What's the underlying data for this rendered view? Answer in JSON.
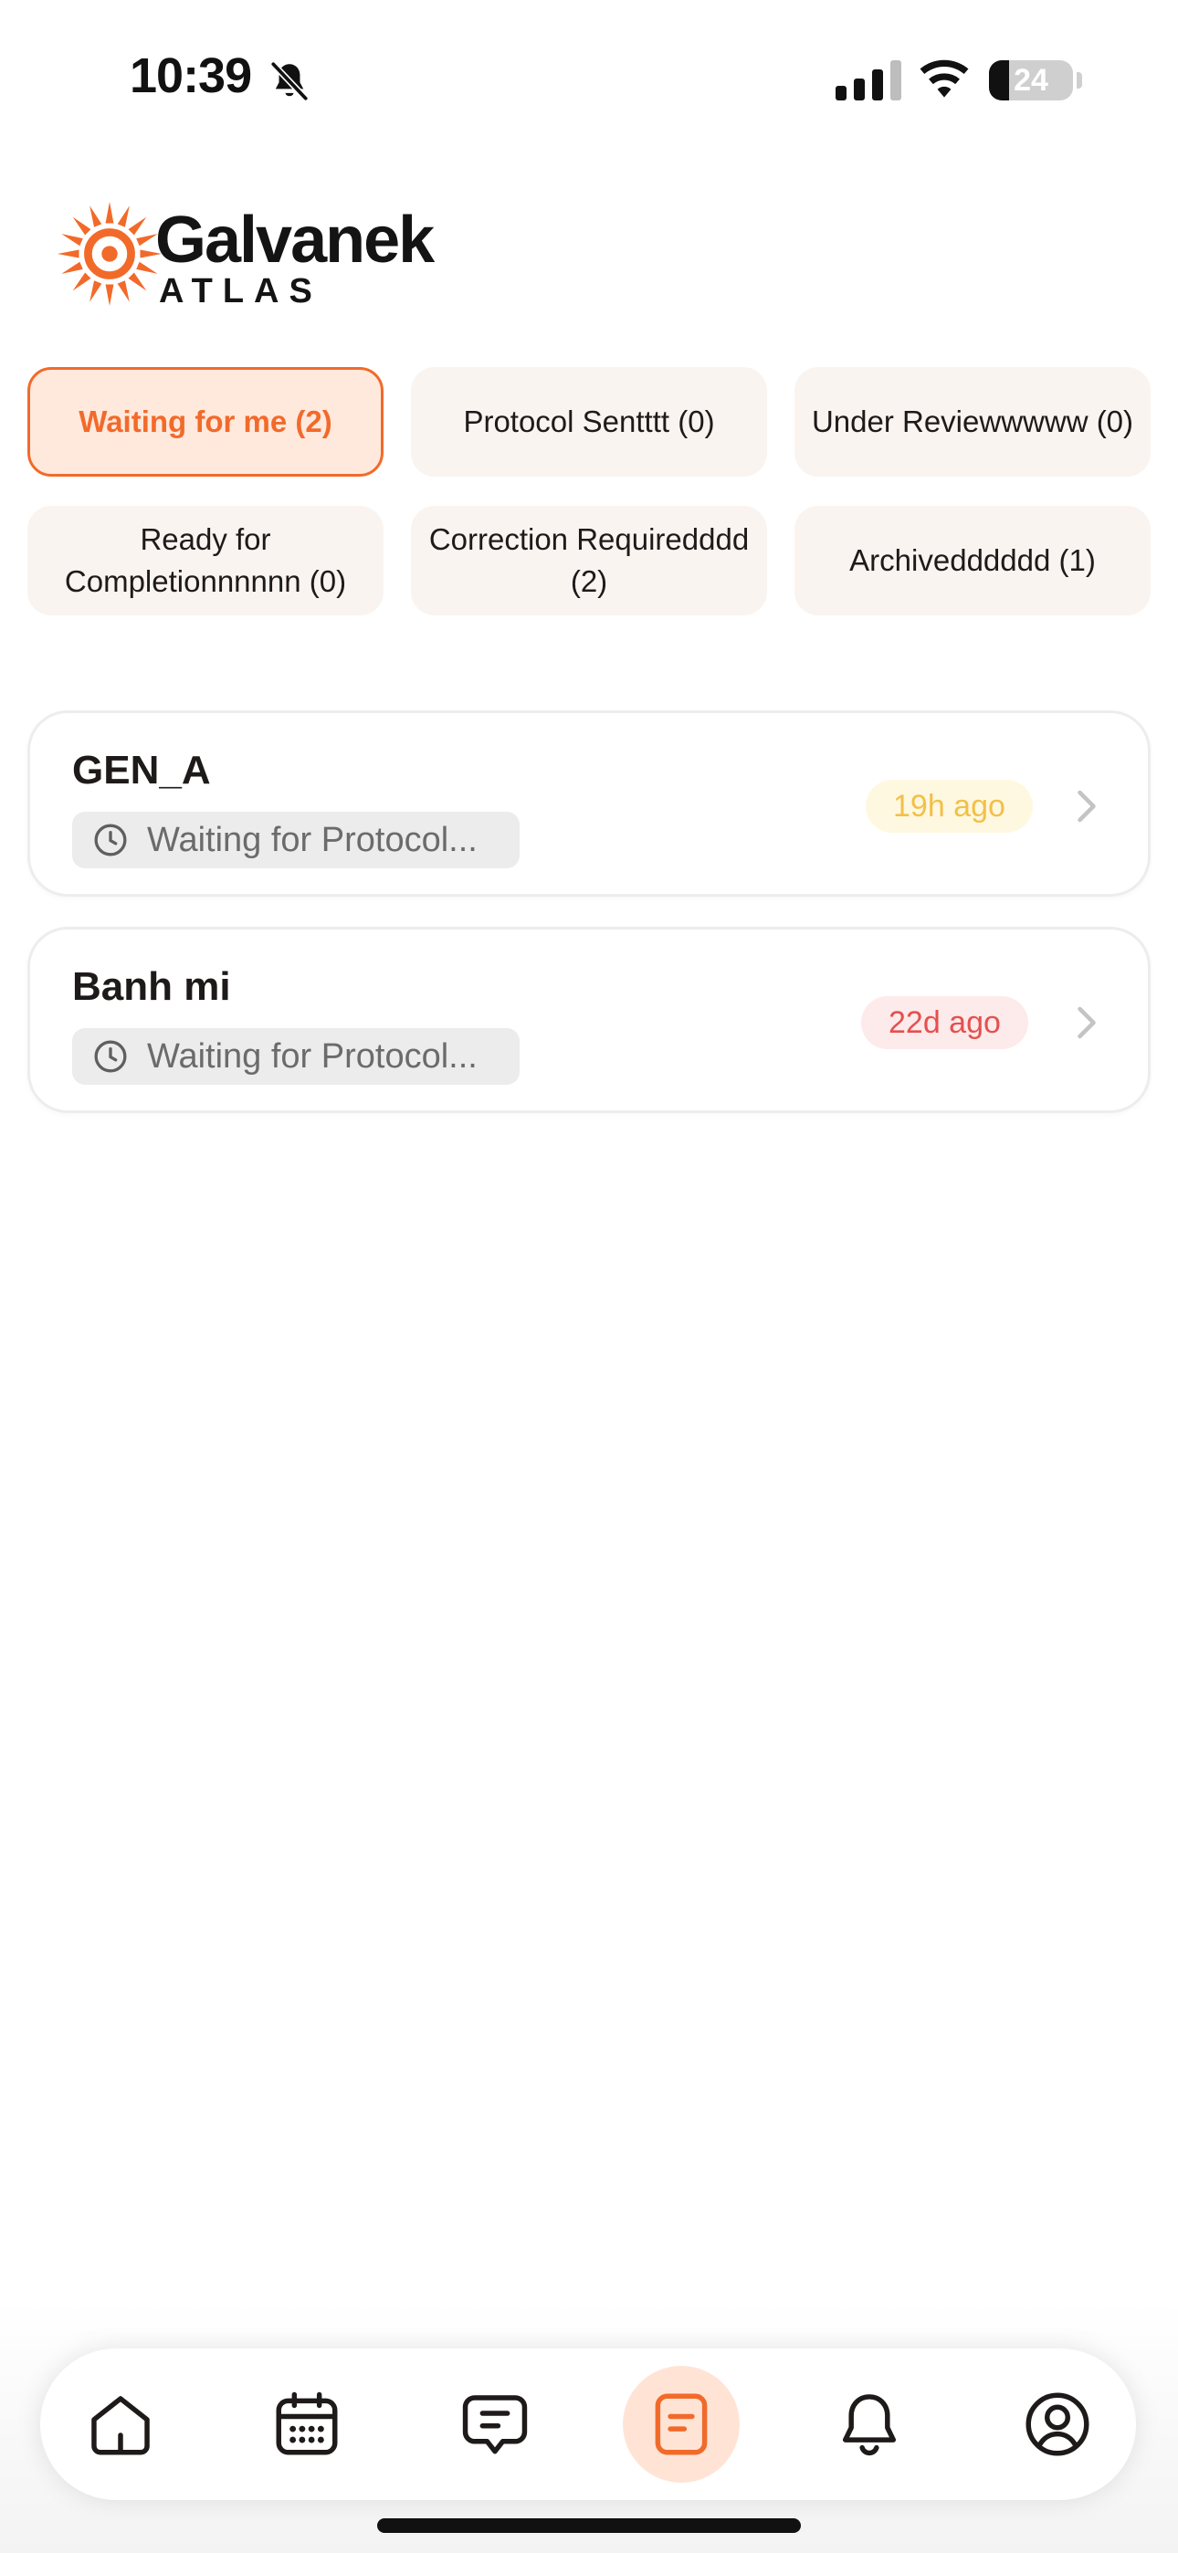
{
  "status_bar": {
    "time": "10:39",
    "battery_level": "24",
    "icons": [
      "bell-slash-icon",
      "cellular-signal-icon",
      "wifi-icon",
      "battery-icon"
    ]
  },
  "logo": {
    "name": "Galvanek",
    "subtitle": "ATLAS",
    "icon": "sun-logo-icon",
    "color": "#f26a2a"
  },
  "filters": [
    {
      "label": "Waiting for me (2)",
      "active": true
    },
    {
      "label": "Protocol Sentttt (0)",
      "active": false
    },
    {
      "label": "Under Reviewwwww (0)",
      "active": false
    },
    {
      "label": "Ready for Completionnnnnn (0)",
      "active": false
    },
    {
      "label": "Correction Requiredddd (2)",
      "active": false
    },
    {
      "label": "Archivedddddd (1)",
      "active": false
    }
  ],
  "items": [
    {
      "title": "GEN_A",
      "status": "Waiting for Protocol...",
      "age": "19h ago",
      "age_color": "#f2c04a"
    },
    {
      "title": "Banh mi",
      "status": "Waiting for Protocol...",
      "age": "22d ago",
      "age_color": "#e55050"
    }
  ],
  "nav": {
    "active_index": 3,
    "accent_color": "#f26a2a",
    "items": [
      "home-icon",
      "calendar-icon",
      "chat-icon",
      "document-icon",
      "bell-icon",
      "profile-icon"
    ]
  }
}
